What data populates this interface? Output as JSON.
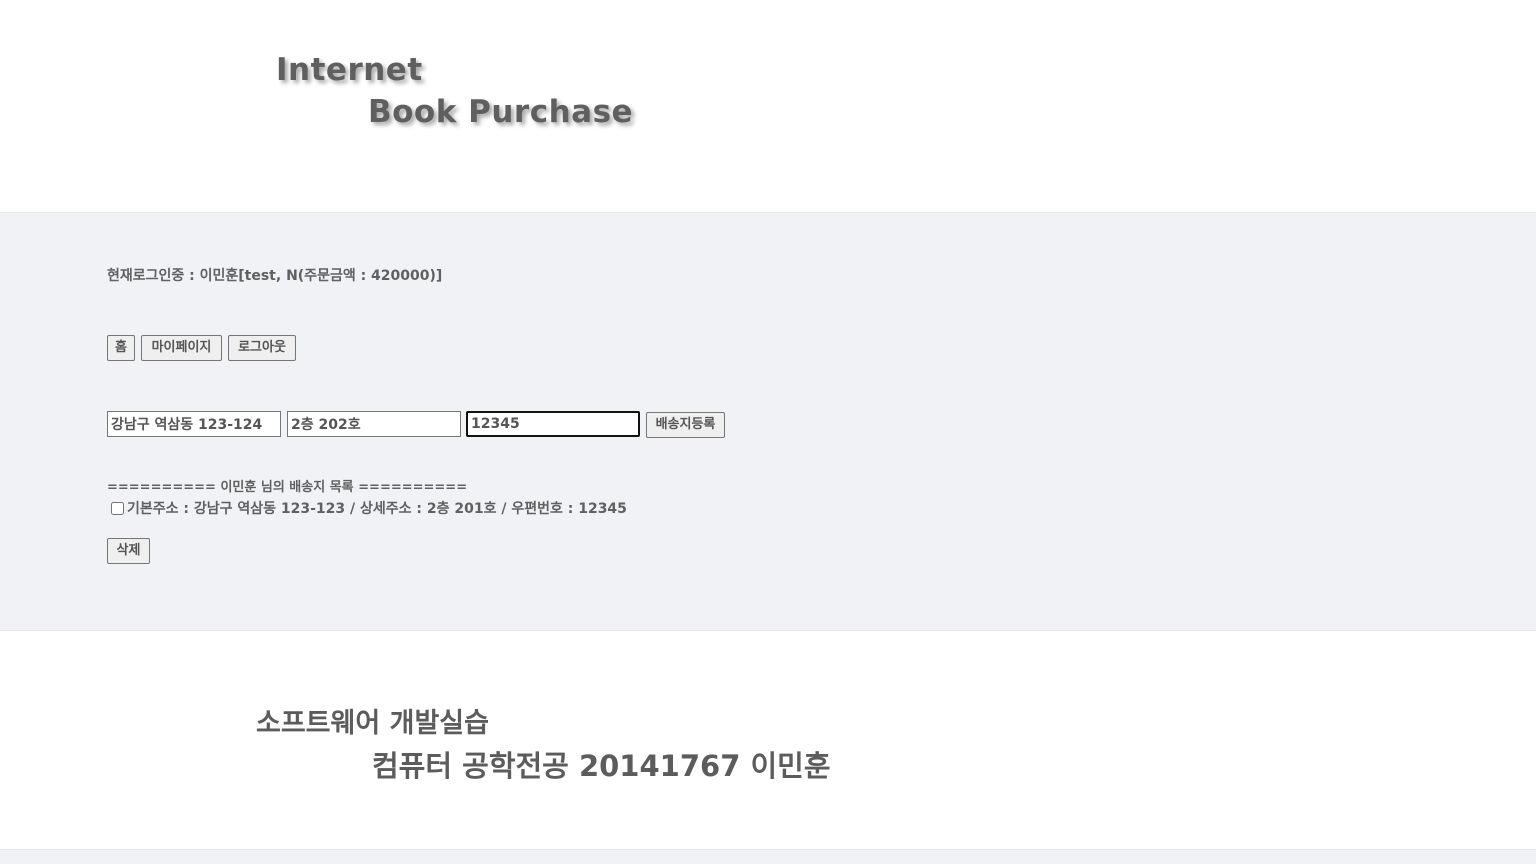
{
  "header": {
    "logo_line1": "Internet",
    "logo_line2": "Book Purchase"
  },
  "session": {
    "login_status": "현재로그인중 : 이민훈[test, N(주문금액 : 420000)]"
  },
  "nav": {
    "home_label": "홈",
    "mypage_label": "마이페이지",
    "logout_label": "로그아웃"
  },
  "address_form": {
    "address_value": "강남구 역삼동 123-124",
    "detail_value": "2층 202호",
    "zipcode_value": "12345",
    "register_label": "배송지등록"
  },
  "address_list": {
    "header": "========== 이민훈 님의 배송지 목록 ==========",
    "items": [
      {
        "text": "기본주소 : 강남구 역삼동 123-123 / 상세주소 : 2층 201호 / 우편번호 : 12345",
        "checked": false
      }
    ],
    "delete_label": "삭제"
  },
  "footer": {
    "line1": "소프트웨어 개발실습",
    "line2": "컴퓨터 공학전공 20141767 이민훈"
  },
  "colors": {
    "main_background": "#f1f2f6",
    "text": "#606060",
    "focus_border": "#111111"
  }
}
